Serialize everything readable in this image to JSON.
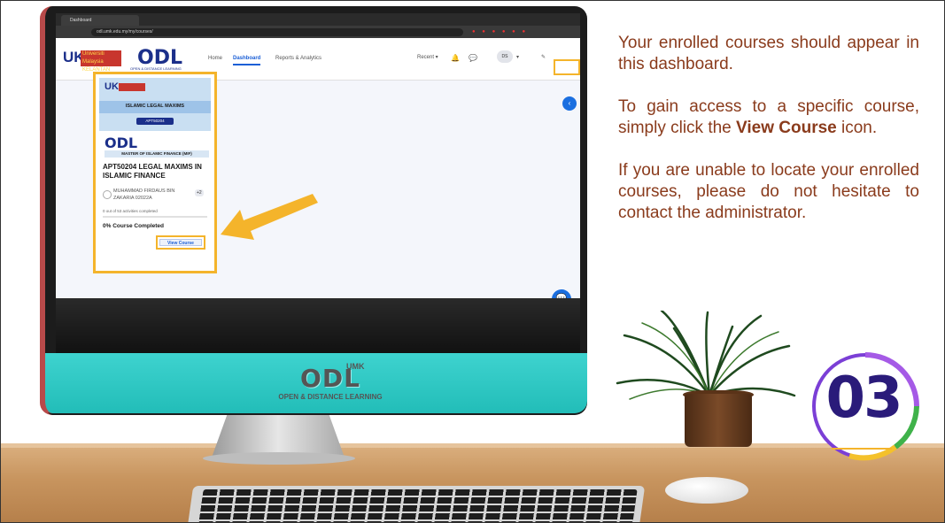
{
  "browser": {
    "tab_title": "Dashboard",
    "url": "odl.umk.edu.my/my/courses/"
  },
  "lms": {
    "logo_uk": "UK",
    "logo_university_name": "Universiti Malaysia KELANTAN",
    "logo_odl": "ODL",
    "logo_odl_tag": "UMK",
    "logo_odl_sub": "OPEN & DISTANCE LEARNING",
    "nav": [
      "Home",
      "Dashboard",
      "Reports & Analytics"
    ],
    "nav_active": "Dashboard",
    "recent_label": "Recent",
    "avatar_initials": "DS"
  },
  "course_card": {
    "image_title": "ISLAMIC LEGAL MAXIMS",
    "image_code": "APT50204",
    "program": "MASTER OF ISLAMIC FINANCE (MIF)",
    "course_name": "APT50204 LEGAL MAXIMS IN ISLAMIC FINANCE",
    "lecturer": "MUHAMMAD FIRDAUS BIN ZAKARIA 02022A",
    "extra_count": "+2",
    "activities": "0 out of 53 activities completed",
    "completion": "0% Course Completed",
    "view_button": "View Course"
  },
  "instructions": {
    "p1": "Your enrolled courses should appear in this dashboard.",
    "p2_a": "To gain access to a specific course, simply click the ",
    "p2_bold": "View Course",
    "p2_b": " icon.",
    "p3": "If you are unable to locate your enrolled courses, please do not hesitate to contact the administrator."
  },
  "step_number": "03",
  "colors": {
    "text_brown": "#8a3b1c",
    "highlight_yellow": "#f4b42b",
    "brand_blue": "#1b2f8a",
    "accent_blue": "#1b6fe0",
    "chin_teal": "#2ec8c3",
    "badge_purple": "#2a1b7a"
  }
}
